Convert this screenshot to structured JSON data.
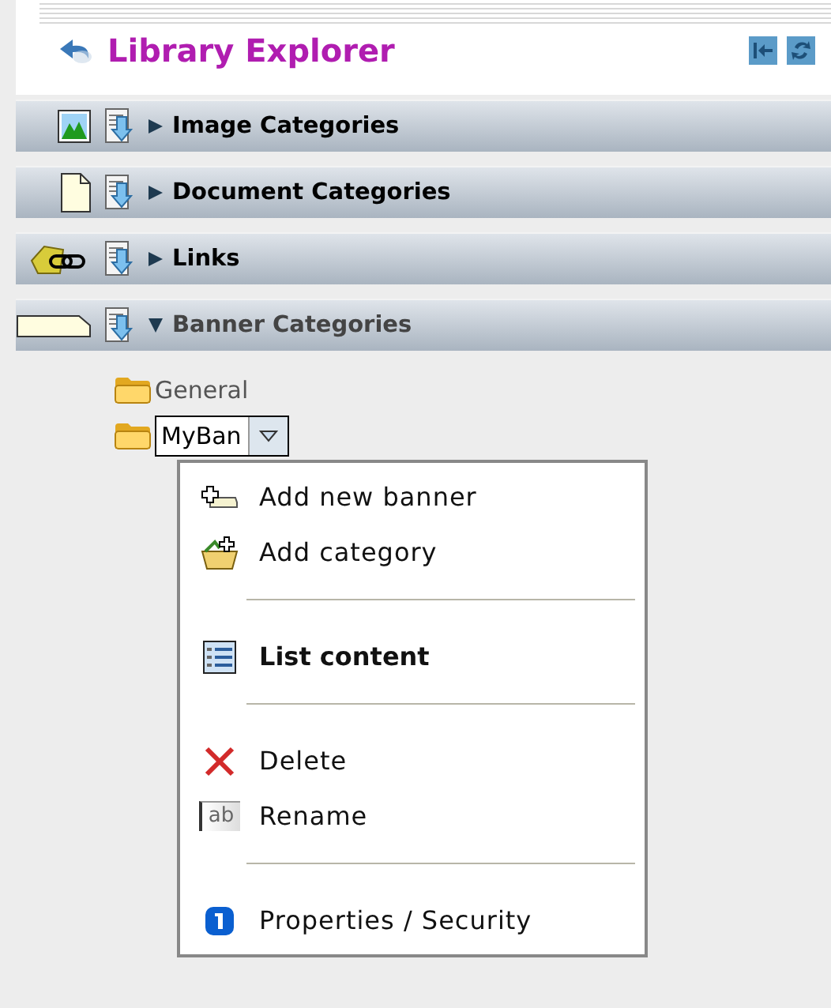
{
  "header": {
    "title": "Library Explorer"
  },
  "categories": [
    {
      "label": "Image Categories",
      "kind": "image",
      "expanded": false
    },
    {
      "label": "Document Categories",
      "kind": "document",
      "expanded": false
    },
    {
      "label": "Links",
      "kind": "links",
      "expanded": false
    },
    {
      "label": "Banner Categories",
      "kind": "banner",
      "expanded": true
    }
  ],
  "tree": [
    {
      "label": "General",
      "editing": false
    },
    {
      "label": "MyBan",
      "editing": true
    }
  ],
  "menu": [
    {
      "kind": "add-banner",
      "label": "Add new banner",
      "bold": false
    },
    {
      "kind": "add-category",
      "label": "Add category",
      "bold": false
    },
    {
      "kind": "separator"
    },
    {
      "kind": "list",
      "label": "List content",
      "bold": true
    },
    {
      "kind": "separator"
    },
    {
      "kind": "delete",
      "label": "Delete",
      "bold": false
    },
    {
      "kind": "rename",
      "label": "Rename",
      "bold": false,
      "icon_text": "ab"
    },
    {
      "kind": "separator"
    },
    {
      "kind": "info",
      "label": "Properties / Security",
      "bold": false
    }
  ]
}
